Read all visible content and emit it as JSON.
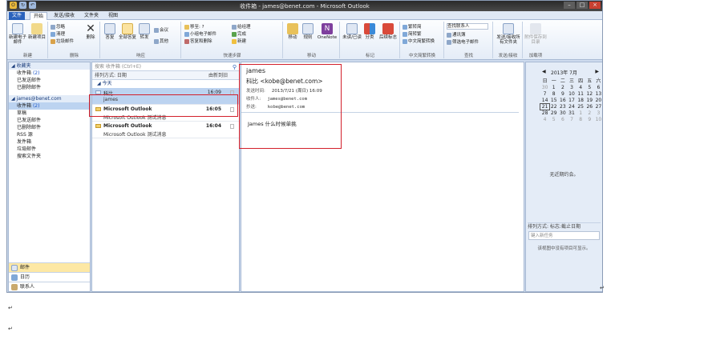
{
  "window": {
    "title": "收件箱 - james@benet.com - Microsoft Outlook"
  },
  "tabs": [
    "文件",
    "开始",
    "发送/接收",
    "文件夹",
    "视图"
  ],
  "ribbon": {
    "groups": [
      {
        "label": "新建",
        "items": [
          "新建电子邮件",
          "新建项目"
        ]
      },
      {
        "label": "删除",
        "items": [
          "忽略",
          "清理",
          "垃圾邮件",
          "删除"
        ]
      },
      {
        "label": "响应",
        "items": [
          "答复",
          "全部答复",
          "转发",
          "会议",
          "其他"
        ]
      },
      {
        "label": "快速步骤",
        "items": [
          "移至: ?",
          "小组电子邮件",
          "答复和删除",
          "给经理",
          "完成",
          "新建"
        ]
      },
      {
        "label": "移动",
        "items": [
          "移动",
          "规则",
          "OneNote"
        ]
      },
      {
        "label": "标记",
        "items": [
          "未读/已读",
          "分类",
          "后续标志"
        ]
      },
      {
        "label": "中文简繁转换",
        "items": [
          "繁转简",
          "简转繁",
          "中文简繁转换"
        ]
      },
      {
        "label": "查找",
        "items": [
          "查找联系人",
          "通讯簿",
          "筛选电子邮件"
        ]
      },
      {
        "label": "发送/接收",
        "items": [
          "发送/接收所有文件夹"
        ]
      },
      {
        "label": "加载项",
        "items": [
          "附件保存到目录"
        ]
      }
    ]
  },
  "nav": {
    "favorites_header": "收藏夹",
    "favorites": [
      {
        "label": "收件箱",
        "count": "(2)"
      },
      {
        "label": "已发送邮件",
        "count": ""
      },
      {
        "label": "已删除邮件",
        "count": ""
      }
    ],
    "account": "james@benet.com",
    "folders": [
      {
        "label": "收件箱",
        "count": "(2)"
      },
      {
        "label": "草稿",
        "count": ""
      },
      {
        "label": "已发送邮件",
        "count": ""
      },
      {
        "label": "已删除邮件",
        "count": ""
      },
      {
        "label": "RSS 源",
        "count": ""
      },
      {
        "label": "发件箱",
        "count": ""
      },
      {
        "label": "垃圾邮件",
        "count": ""
      },
      {
        "label": "搜索文件夹",
        "count": ""
      }
    ],
    "bottom": [
      "邮件",
      "日历",
      "联系人"
    ]
  },
  "list": {
    "search_placeholder": "搜索 收件箱 (Ctrl+E)",
    "arrange_by": "排列方式: 日期",
    "order": "由新到旧",
    "group": "今天",
    "mails": [
      {
        "from": "科比",
        "subject": "james",
        "time": "16:09"
      },
      {
        "from": "Microsoft Outlook",
        "subject": "Microsoft Outlook 测试消息",
        "time": "16:05"
      },
      {
        "from": "Microsoft Outlook",
        "subject": "Microsoft Outlook 测试消息",
        "time": "16:04"
      }
    ]
  },
  "reading": {
    "subject": "james",
    "sender": "科比 <kobe@benet.com>",
    "sent_label": "发送时间:",
    "sent_value": "2013/7/21 (周日) 16:09",
    "to_label": "收件人:",
    "to_value": "james@benet.com",
    "cc_label": "抄送:",
    "cc_value": "kobe@benet.com",
    "body": "James 什么时候单挑"
  },
  "todo": {
    "month": "2013年 7月",
    "weekdays": [
      "日",
      "一",
      "二",
      "三",
      "四",
      "五",
      "六"
    ],
    "days": [
      "30",
      "1",
      "2",
      "3",
      "4",
      "5",
      "6",
      "7",
      "8",
      "9",
      "10",
      "11",
      "12",
      "13",
      "14",
      "15",
      "16",
      "17",
      "18",
      "19",
      "20",
      "21",
      "22",
      "23",
      "24",
      "25",
      "26",
      "27",
      "28",
      "29",
      "30",
      "31",
      "1",
      "2",
      "3",
      "4",
      "5",
      "6",
      "7",
      "8",
      "9",
      "10"
    ],
    "no_appointments": "无近期约会。",
    "task_header": "排列方式: 标志:截止日期",
    "task_placeholder": "键入新任务",
    "task_empty": "该视图中没有项目可显示。"
  },
  "doc_marks": [
    "↵",
    "↵",
    "↵"
  ]
}
